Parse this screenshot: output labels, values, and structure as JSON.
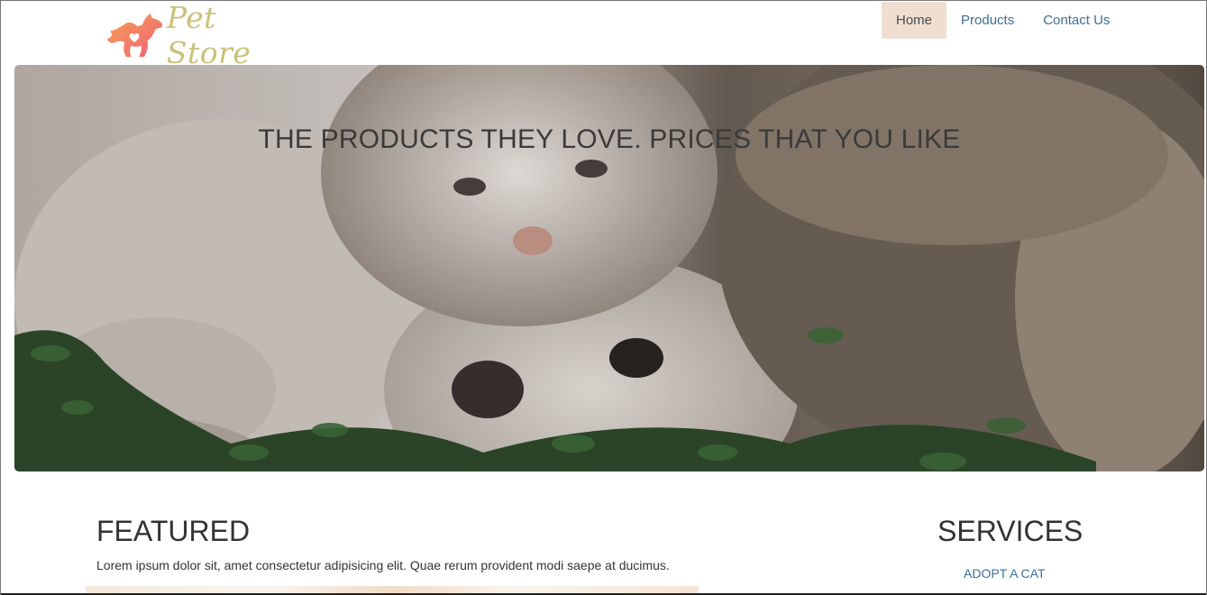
{
  "brand": {
    "name": "Pet Store",
    "logo_icon": "running-dog-heart-logo",
    "logo_color": "#f3816a",
    "text_color": "#c9c27a"
  },
  "nav": {
    "items": [
      {
        "label": "Home",
        "active": true
      },
      {
        "label": "Products",
        "active": false
      },
      {
        "label": "Contact Us",
        "active": false
      }
    ],
    "active_bg": "#f0dfd1",
    "link_color": "#3f6f93"
  },
  "hero": {
    "title": "THE PRODUCTS THEY LOVE. PRICES THAT YOU LIKE",
    "image": "cat-and-dog-lying-in-grass-photo"
  },
  "featured": {
    "title": "FEATURED",
    "text": "Lorem ipsum dolor sit, amet consectetur adipisicing elit. Quae rerum provident modi saepe at ducimus."
  },
  "services": {
    "title": "SERVICES",
    "links": [
      "ADOPT A CAT"
    ]
  }
}
